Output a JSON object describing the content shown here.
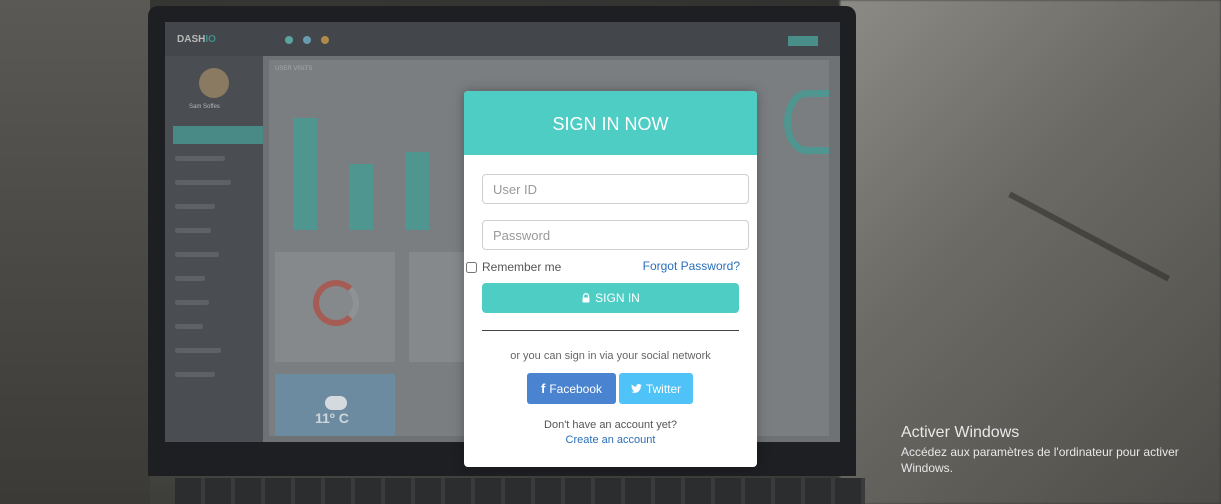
{
  "modal": {
    "title": "SIGN IN NOW",
    "user_id_placeholder": "User ID",
    "password_placeholder": "Password",
    "remember_label": "Remember me",
    "remember_checked": false,
    "forgot_label": "Forgot Password?",
    "signin_label": "SIGN IN",
    "social_text": "or you can sign in via your social network",
    "facebook_label": "Facebook",
    "twitter_label": "Twitter",
    "no_account_text": "Don't have an account yet?",
    "create_account_label": "Create an account"
  },
  "background": {
    "dashboard_logo_a": "DASH",
    "dashboard_logo_b": "IO",
    "user_name": "Sam Soffes",
    "chart_title": "USER VISITS",
    "weather_temp": "11º C"
  },
  "windows_notice": {
    "title": "Activer Windows",
    "subtitle": "Accédez aux paramètres de l'ordinateur pour activer Windows."
  },
  "colors": {
    "accent": "#4ecdc4",
    "facebook": "#4a83cf",
    "twitter": "#4fc3f7",
    "link": "#2a6fba"
  },
  "icons": {
    "signin": "lock-icon",
    "facebook": "facebook-icon",
    "twitter": "twitter-icon"
  }
}
